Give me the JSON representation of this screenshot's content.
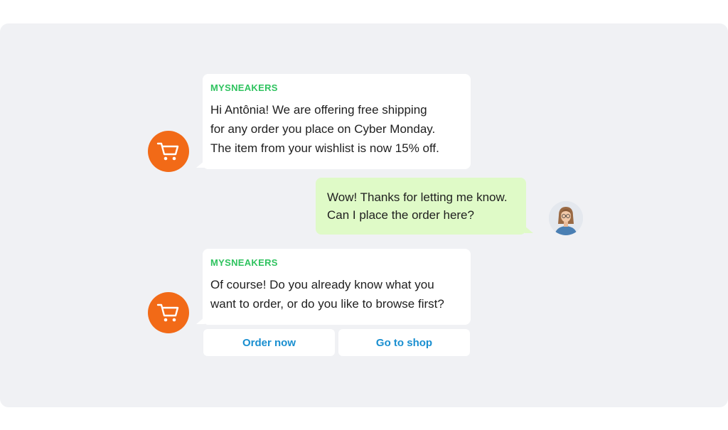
{
  "chat": {
    "messages": [
      {
        "sender": "MYSNEAKERS",
        "text": "Hi Antônia! We are offering free shipping\nfor any order you place on Cyber Monday.\nThe item from your wishlist is now 15% off."
      },
      {
        "text": "Wow! Thanks for letting me know.\nCan I place the order here?"
      },
      {
        "sender": "MYSNEAKERS",
        "text": "Of course! Do you already know what you\nwant to order, or do you like to browse first?"
      }
    ],
    "quick_replies": [
      "Order now",
      "Go to shop"
    ]
  },
  "colors": {
    "bot_avatar": "#f26a17",
    "sender_name": "#2fc35f",
    "user_bubble": "#dffac7",
    "quick_reply_text": "#1a8fd0"
  },
  "icons": {
    "bot_avatar": "shopping-cart-icon",
    "user_avatar": "user-photo"
  }
}
